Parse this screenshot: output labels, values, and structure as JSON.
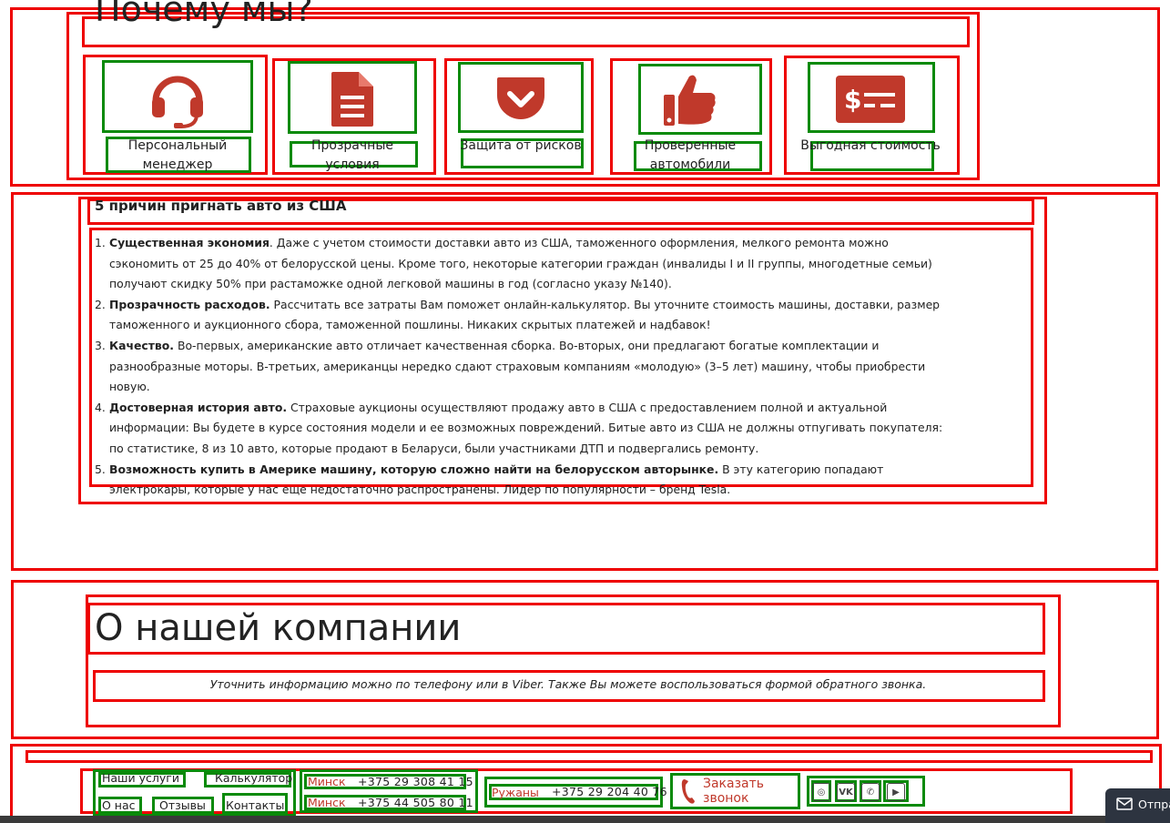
{
  "why_us": {
    "title": "Почему мы?",
    "features": [
      {
        "icon": "headset-icon",
        "label": "Персональный менеджер"
      },
      {
        "icon": "document-icon",
        "label": "Прозрачные условия"
      },
      {
        "icon": "pocket-shield-icon",
        "label": "Защита от рисков"
      },
      {
        "icon": "thumbs-up-icon",
        "label": "Проверенные автомобили"
      },
      {
        "icon": "dollar-card-icon",
        "label": "Выгодная стоимость"
      }
    ],
    "accent_color": "#c0392b"
  },
  "reasons": {
    "title": "5 причин пригнать авто из США",
    "items": [
      {
        "num": "1.",
        "bold": "Существенная экономия",
        "text": ". Даже с учетом стоимости доставки авто из США, таможенного оформления, мелкого ремонта можно сэкономить от 25 до 40% от белорусской цены. Кроме того, некоторые категории граждан (инвалиды I и II группы, многодетные семьи) получают скидку 50% при растаможке одной легковой машины в год (согласно указу №140)."
      },
      {
        "num": "2.",
        "bold": "Прозрачность расходов.",
        "text": " Рассчитать все затраты Вам поможет онлайн-калькулятор. Вы уточните стоимость машины, доставки, размер таможенного и аукционного сбора, таможенной пошлины. Никаких скрытых платежей и надбавок!"
      },
      {
        "num": "3.",
        "bold": "Качество.",
        "text": " Во-первых, американские авто отличает качественная сборка. Во-вторых, они предлагают богатые комплектации и разнообразные моторы. В-третьих, американцы нередко сдают страховым компаниям «молодую» (3–5 лет) машину, чтобы приобрести новую."
      },
      {
        "num": "4.",
        "bold": "Достоверная история авто.",
        "text": " Страховые аукционы осуществляют продажу авто в США с предоставлением полной и актуальной информации: Вы будете в курсе состояния модели и ее возможных повреждений. Битые авто из США не должны отпугивать покупателя: по статистике, 8 из 10 авто, которые продают в Беларуси, были участниками ДТП и подвергались ремонту."
      },
      {
        "num": "5.",
        "bold": "Возможность купить в Америке машину, которую сложно найти на белорусском авторынке.",
        "text": " В эту категорию попадают электрокары, которые у нас еще недостаточно распространены. Лидер по популярности – бренд Tesla."
      }
    ]
  },
  "about": {
    "title": "О нашей компании",
    "text": "Уточнить информацию можно по телефону или в Viber. Также Вы можете воспользоваться формой обратного звонка."
  },
  "footer": {
    "links": [
      "Наши услуги",
      "Калькулятор",
      "О нас",
      "Отзывы",
      "Контакты"
    ],
    "phones": [
      {
        "city": "Минск",
        "number": "+375 29 308 41 15"
      },
      {
        "city": "Минск",
        "number": "+375 44 505 80 11"
      },
      {
        "city": "Ружаны",
        "number": "+375 29 204 40 76"
      }
    ],
    "callback_label": "Заказать звонок",
    "socials": [
      {
        "icon": "instagram-icon",
        "glyph": "◎"
      },
      {
        "icon": "vk-icon",
        "glyph": "VK"
      },
      {
        "icon": "viber-icon",
        "glyph": "✆"
      },
      {
        "icon": "youtube-icon",
        "glyph": "▶"
      }
    ],
    "send_label": "Отпра"
  }
}
